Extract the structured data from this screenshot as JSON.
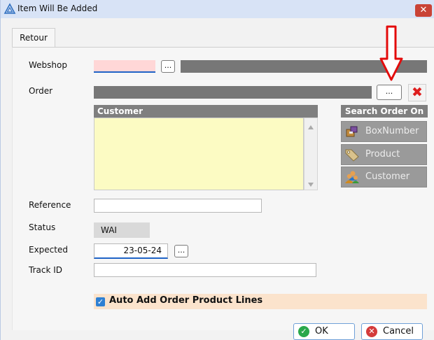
{
  "window": {
    "title": "Item Will Be Added",
    "close_glyph": "✕"
  },
  "tabs": [
    {
      "label": "Retour"
    }
  ],
  "form": {
    "webshop": {
      "label": "Webshop",
      "value": "",
      "browse_label": "..."
    },
    "order": {
      "label": "Order",
      "value": "",
      "browse_label": "...",
      "delete_glyph": "✖"
    },
    "customer": {
      "header": "Customer",
      "value": ""
    },
    "search_order_on": {
      "header": "Search Order On",
      "buttons": [
        {
          "label": "BoxNumber",
          "icon": "box-icon"
        },
        {
          "label": "Product",
          "icon": "tag-icon"
        },
        {
          "label": "Customer",
          "icon": "users-icon"
        }
      ]
    },
    "reference": {
      "label": "Reference",
      "value": ""
    },
    "status": {
      "label": "Status",
      "value": "WAI"
    },
    "expected": {
      "label": "Expected",
      "value": "23-05-24",
      "browse_label": "..."
    },
    "track_id": {
      "label": "Track ID",
      "value": ""
    },
    "auto_add": {
      "label": "Auto Add Order Product Lines",
      "checked": true,
      "check_glyph": "✓"
    }
  },
  "footer": {
    "ok": {
      "label": "OK",
      "glyph": "✓"
    },
    "cancel": {
      "label": "Cancel",
      "glyph": "✕"
    }
  },
  "colors": {
    "required_field": "#ffd7d7",
    "customer_area": "#fcfbc3",
    "auto_add_row": "#fbe3cc",
    "annotation_arrow": "#e30b0b"
  }
}
